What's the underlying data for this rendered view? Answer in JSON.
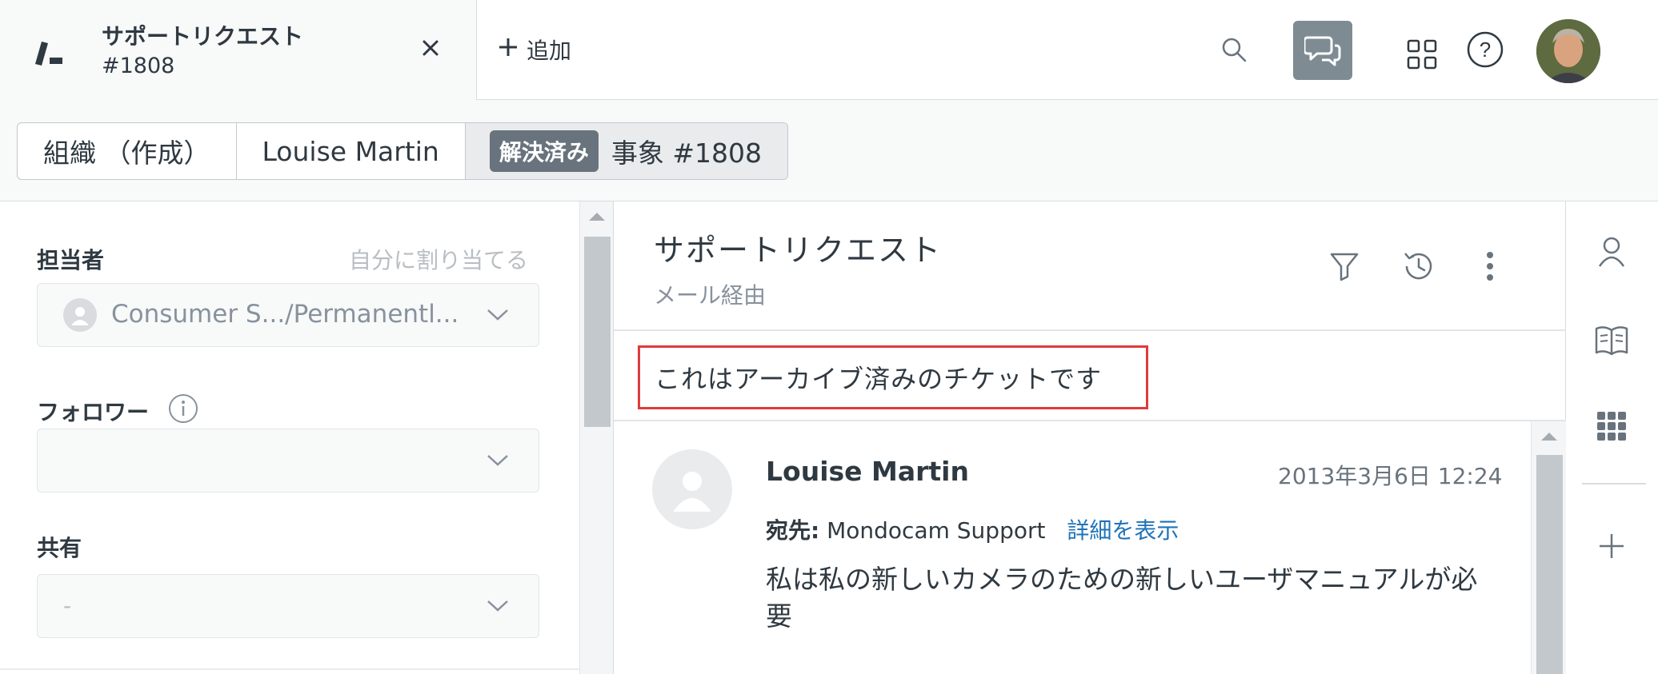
{
  "ticket_tab": {
    "title": "サポートリクエスト",
    "number": "#1808"
  },
  "add_tab": {
    "label": "追加"
  },
  "breadcrumb": {
    "organization": "組織 （作成）",
    "requester": "Louise Martin",
    "status": "解決済み",
    "ticket": "事象 #1808"
  },
  "properties": {
    "assignee_label": "担当者",
    "assign_to_me": "自分に割り当てる",
    "assignee_value": "Consumer S.../Permanentl...",
    "followers_label": "フォロワー",
    "shared_label": "共有",
    "shared_value": "-"
  },
  "conversation": {
    "title": "サポートリクエスト",
    "channel": "メール経由",
    "archived_notice": "これはアーカイブ済みのチケットです",
    "message": {
      "author": "Louise Martin",
      "timestamp": "2013年3月6日 12:24",
      "to_label": "宛先:",
      "to_value": "Mondocam Support",
      "details_link": "詳細を表示",
      "body": "私は私の新しいカメラのための新しいユーザマニュアルが必要"
    }
  },
  "colors": {
    "accent_link": "#1f73b7",
    "highlight_border": "#e03b3b",
    "status_badge": "#68737d",
    "chat_button": "#7e8b93"
  },
  "icons": {
    "brand": "zendesk-logo-icon",
    "close": "close-icon",
    "add": "plus-icon",
    "search": "search-icon",
    "chat": "conversations-icon",
    "apps": "product-tray-icon",
    "help": "help-icon",
    "filter": "filter-icon",
    "history": "history-icon",
    "more": "more-vertical-icon",
    "user": "user-icon",
    "knowledge": "book-icon",
    "apps_grid": "apps-grid-icon",
    "add_app": "plus-icon"
  }
}
